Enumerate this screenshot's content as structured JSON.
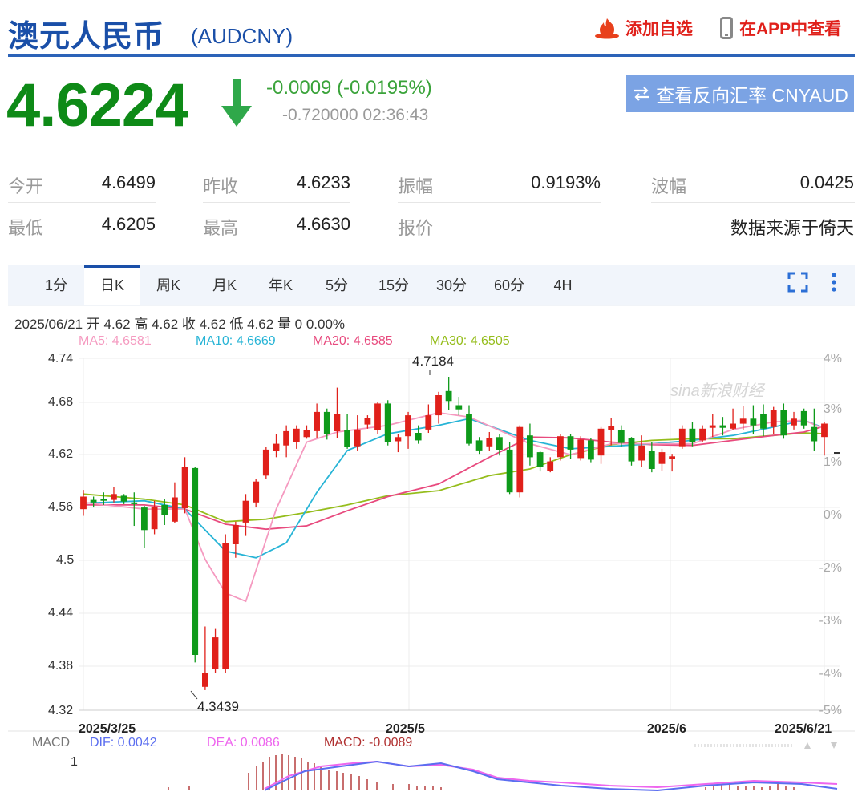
{
  "header": {
    "title": "澳元人民币",
    "symbol": "(AUDCNY)",
    "add_favorite": "添加自选",
    "view_in_app": "在APP中查看"
  },
  "quote": {
    "price": "4.6224",
    "change": "-0.0009 (-0.0195%)",
    "sub": "-0.720000 02:36:43",
    "reverse_button": "查看反向汇率 CNYAUD",
    "direction": "down",
    "colors": {
      "down": "#0e8a17",
      "up": "#e0201a",
      "accent": "#1a4fa8"
    }
  },
  "stats": {
    "open_label": "今开",
    "open": "4.6499",
    "prev_label": "昨收",
    "prev": "4.6233",
    "amp_label": "振幅",
    "amp": "0.9193%",
    "wave_label": "波幅",
    "wave": "0.0425",
    "low_label": "最低",
    "low": "4.6205",
    "high_label": "最高",
    "high": "4.6630",
    "quote_label": "报价",
    "source": "数据来源于倚天"
  },
  "tabs": [
    "1分",
    "日K",
    "周K",
    "月K",
    "年K",
    "5分",
    "15分",
    "30分",
    "60分",
    "4H"
  ],
  "active_tab": "日K",
  "info_line": "2025/06/21 开 4.62 高 4.62 收 4.62 低 4.62 量 0 0.00%",
  "ma_labels": {
    "ma5": "MA5: 4.6581",
    "ma10": "MA10: 4.6669",
    "ma20": "MA20: 4.6585",
    "ma30": "MA30: 4.6505"
  },
  "ma_colors": {
    "ma5": "#f59ac0",
    "ma10": "#27b4d6",
    "ma20": "#e84a7e",
    "ma30": "#95bd1c"
  },
  "chart_data": {
    "type": "candlestick",
    "y_ticks": [
      "4.74",
      "4.68",
      "4.62",
      "4.56",
      "4.5",
      "4.44",
      "4.38",
      "4.32"
    ],
    "pct_ticks": [
      "4%",
      "3%",
      "1%",
      "0%",
      "-2%",
      "-3%",
      "-4%",
      "-5%"
    ],
    "x_ticks": [
      "2025/3/25",
      "2025/5",
      "2025/6",
      "2025/6/21"
    ],
    "ylim": [
      4.32,
      4.74
    ],
    "annotations": {
      "max": "4.7184",
      "min": "4.3439"
    },
    "watermark": "sina新浪财经",
    "candles": [
      [
        4.56,
        4.575,
        4.552,
        4.583
      ],
      [
        4.571,
        4.568,
        4.562,
        4.575
      ],
      [
        4.572,
        4.57,
        4.565,
        4.58
      ],
      [
        4.571,
        4.578,
        4.568,
        4.586
      ],
      [
        4.576,
        4.569,
        4.566,
        4.578
      ],
      [
        4.568,
        4.566,
        4.54,
        4.58
      ],
      [
        4.562,
        4.535,
        4.514,
        4.564
      ],
      [
        4.536,
        4.563,
        4.53,
        4.57
      ],
      [
        4.565,
        4.553,
        4.541,
        4.572
      ],
      [
        4.545,
        4.574,
        4.543,
        4.592
      ],
      [
        4.561,
        4.61,
        4.555,
        4.622
      ],
      [
        4.609,
        4.386,
        4.377,
        4.61
      ],
      [
        4.348,
        4.365,
        4.344,
        4.42
      ],
      [
        4.369,
        4.407,
        4.364,
        4.417
      ],
      [
        4.369,
        4.519,
        4.365,
        4.53
      ],
      [
        4.518,
        4.541,
        4.502,
        4.545
      ],
      [
        4.544,
        4.57,
        4.528,
        4.578
      ],
      [
        4.568,
        4.593,
        4.562,
        4.596
      ],
      [
        4.6,
        4.631,
        4.596,
        4.634
      ],
      [
        4.63,
        4.638,
        4.622,
        4.65
      ],
      [
        4.636,
        4.653,
        4.622,
        4.66
      ],
      [
        4.64,
        4.656,
        4.632,
        4.66
      ],
      [
        4.646,
        4.654,
        4.644,
        4.66
      ],
      [
        4.653,
        4.676,
        4.645,
        4.686
      ],
      [
        4.676,
        4.65,
        4.643,
        4.68
      ],
      [
        4.653,
        4.674,
        4.645,
        4.705
      ],
      [
        4.654,
        4.634,
        4.632,
        4.674
      ],
      [
        4.635,
        4.655,
        4.63,
        4.672
      ],
      [
        4.661,
        4.669,
        4.656,
        4.672
      ],
      [
        4.654,
        4.686,
        4.65,
        4.688
      ],
      [
        4.686,
        4.64,
        4.636,
        4.69
      ],
      [
        4.641,
        4.646,
        4.628,
        4.65
      ],
      [
        4.647,
        4.672,
        4.632,
        4.676
      ],
      [
        4.651,
        4.642,
        4.638,
        4.66
      ],
      [
        4.655,
        4.672,
        4.651,
        4.685
      ],
      [
        4.672,
        4.696,
        4.662,
        4.7
      ],
      [
        4.701,
        4.689,
        4.678,
        4.718
      ],
      [
        4.684,
        4.679,
        4.672,
        4.694
      ],
      [
        4.674,
        4.638,
        4.636,
        4.684
      ],
      [
        4.642,
        4.63,
        4.626,
        4.646
      ],
      [
        4.635,
        4.645,
        4.63,
        4.652
      ],
      [
        4.646,
        4.631,
        4.624,
        4.65
      ],
      [
        4.631,
        4.58,
        4.578,
        4.64
      ],
      [
        4.58,
        4.658,
        4.574,
        4.66
      ],
      [
        4.648,
        4.622,
        4.612,
        4.662
      ],
      [
        4.628,
        4.61,
        4.605,
        4.63
      ],
      [
        4.606,
        4.617,
        4.604,
        4.622
      ],
      [
        4.622,
        4.647,
        4.618,
        4.65
      ],
      [
        4.647,
        4.631,
        4.62,
        4.65
      ],
      [
        4.621,
        4.643,
        4.618,
        4.647
      ],
      [
        4.642,
        4.619,
        4.616,
        4.645
      ],
      [
        4.624,
        4.656,
        4.614,
        4.658
      ],
      [
        4.654,
        4.659,
        4.636,
        4.669
      ],
      [
        4.654,
        4.639,
        4.634,
        4.66
      ],
      [
        4.645,
        4.617,
        4.612,
        4.646
      ],
      [
        4.618,
        4.636,
        4.61,
        4.648
      ],
      [
        4.63,
        4.608,
        4.604,
        4.64
      ],
      [
        4.614,
        4.628,
        4.606,
        4.632
      ],
      [
        4.62,
        4.623,
        4.605,
        4.626
      ],
      [
        4.635,
        4.656,
        4.632,
        4.66
      ],
      [
        4.656,
        4.64,
        4.635,
        4.664
      ],
      [
        4.642,
        4.656,
        4.64,
        4.66
      ],
      [
        4.657,
        4.66,
        4.646,
        4.674
      ],
      [
        4.66,
        4.657,
        4.648,
        4.67
      ],
      [
        4.656,
        4.662,
        4.654,
        4.68
      ],
      [
        4.662,
        4.668,
        4.654,
        4.683
      ],
      [
        4.668,
        4.66,
        4.65,
        4.684
      ],
      [
        4.673,
        4.656,
        4.647,
        4.685
      ],
      [
        4.658,
        4.678,
        4.65,
        4.682
      ],
      [
        4.678,
        4.648,
        4.644,
        4.686
      ],
      [
        4.66,
        4.668,
        4.655,
        4.676
      ],
      [
        4.677,
        4.66,
        4.656,
        4.68
      ],
      [
        4.658,
        4.641,
        4.63,
        4.68
      ],
      [
        4.646,
        4.662,
        4.624,
        4.664
      ]
    ],
    "ma_series": {
      "ma5": [
        [
          0,
          4.568
        ],
        [
          6,
          4.56
        ],
        [
          10,
          4.56
        ],
        [
          12,
          4.5
        ],
        [
          14,
          4.46
        ],
        [
          16,
          4.45
        ],
        [
          19,
          4.56
        ],
        [
          22,
          4.64
        ],
        [
          25,
          4.652
        ],
        [
          30,
          4.66
        ],
        [
          35,
          4.675
        ],
        [
          38,
          4.67
        ],
        [
          44,
          4.638
        ],
        [
          48,
          4.625
        ],
        [
          52,
          4.638
        ],
        [
          56,
          4.638
        ],
        [
          60,
          4.638
        ],
        [
          64,
          4.655
        ],
        [
          68,
          4.664
        ],
        [
          71,
          4.666
        ],
        [
          73,
          4.656
        ]
      ],
      "ma10": [
        [
          0,
          4.567
        ],
        [
          6,
          4.57
        ],
        [
          10,
          4.56
        ],
        [
          14,
          4.51
        ],
        [
          17,
          4.502
        ],
        [
          20,
          4.52
        ],
        [
          23,
          4.58
        ],
        [
          26,
          4.63
        ],
        [
          30,
          4.65
        ],
        [
          35,
          4.66
        ],
        [
          38,
          4.668
        ],
        [
          44,
          4.642
        ],
        [
          48,
          4.632
        ],
        [
          52,
          4.635
        ],
        [
          56,
          4.638
        ],
        [
          60,
          4.642
        ],
        [
          64,
          4.648
        ],
        [
          68,
          4.658
        ],
        [
          71,
          4.666
        ],
        [
          73,
          4.657
        ]
      ],
      "ma20": [
        [
          0,
          4.565
        ],
        [
          6,
          4.565
        ],
        [
          10,
          4.56
        ],
        [
          14,
          4.542
        ],
        [
          18,
          4.536
        ],
        [
          22,
          4.54
        ],
        [
          26,
          4.558
        ],
        [
          30,
          4.575
        ],
        [
          35,
          4.59
        ],
        [
          40,
          4.622
        ],
        [
          44,
          4.646
        ],
        [
          48,
          4.645
        ],
        [
          52,
          4.64
        ],
        [
          56,
          4.637
        ],
        [
          60,
          4.636
        ],
        [
          64,
          4.642
        ],
        [
          68,
          4.648
        ],
        [
          71,
          4.652
        ],
        [
          73,
          4.659
        ]
      ],
      "ma30": [
        [
          0,
          4.578
        ],
        [
          6,
          4.572
        ],
        [
          10,
          4.565
        ],
        [
          14,
          4.545
        ],
        [
          18,
          4.548
        ],
        [
          22,
          4.556
        ],
        [
          26,
          4.565
        ],
        [
          30,
          4.576
        ],
        [
          35,
          4.582
        ],
        [
          40,
          4.6
        ],
        [
          44,
          4.608
        ],
        [
          48,
          4.625
        ],
        [
          52,
          4.637
        ],
        [
          56,
          4.642
        ],
        [
          60,
          4.644
        ],
        [
          64,
          4.644
        ],
        [
          68,
          4.648
        ],
        [
          71,
          4.651
        ],
        [
          73,
          4.65
        ]
      ]
    }
  },
  "macd": {
    "label": "MACD",
    "dif": "DIF: 0.0042",
    "dea": "DEA: 0.0086",
    "value": "MACD: -0.0089",
    "y_tick": "1",
    "colors": {
      "dif": "#5b6ef0",
      "dea": "#ee66ee",
      "macd": "#b03030"
    }
  }
}
